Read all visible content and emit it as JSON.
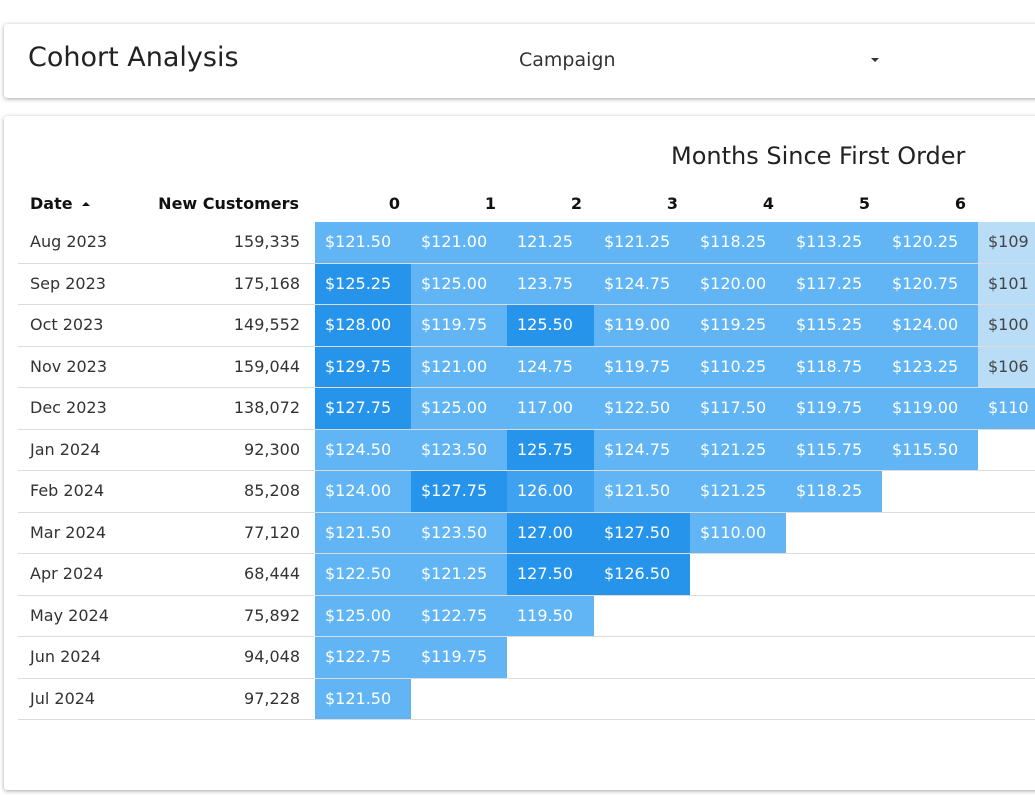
{
  "header": {
    "title": "Cohort Analysis",
    "dropdown_value": "Campaign"
  },
  "table": {
    "group_title": "Months Since First Order",
    "columns": {
      "date": "Date",
      "new_customers": "New Customers",
      "months": [
        "0",
        "1",
        "2",
        "3",
        "4",
        "5",
        "6"
      ]
    },
    "colors": {
      "light": "#62b5f4",
      "medium": "#3ea2f0",
      "dark": "#2794ec",
      "pale": "#b9dcf7"
    },
    "rows": [
      {
        "date": "Aug 2023",
        "new_customers": "159,335",
        "values": [
          "$121.50",
          "$121.00",
          "121.25",
          "$121.25",
          "$118.25",
          "$113.25",
          "$120.25",
          "$109"
        ],
        "shades": [
          "light",
          "light",
          "light",
          "light",
          "light",
          "light",
          "light",
          "pale"
        ]
      },
      {
        "date": "Sep 2023",
        "new_customers": "175,168",
        "values": [
          "$125.25",
          "$125.00",
          "123.75",
          "$124.75",
          "$120.00",
          "$117.25",
          "$120.75",
          "$101"
        ],
        "shades": [
          "dark",
          "light",
          "light",
          "light",
          "light",
          "light",
          "light",
          "pale"
        ]
      },
      {
        "date": "Oct 2023",
        "new_customers": "149,552",
        "values": [
          "$128.00",
          "$119.75",
          "125.50",
          "$119.00",
          "$119.25",
          "$115.25",
          "$124.00",
          "$100"
        ],
        "shades": [
          "dark",
          "light",
          "dark",
          "light",
          "light",
          "light",
          "light",
          "pale"
        ]
      },
      {
        "date": "Nov 2023",
        "new_customers": "159,044",
        "values": [
          "$129.75",
          "$121.00",
          "124.75",
          "$119.75",
          "$110.25",
          "$118.75",
          "$123.25",
          "$106"
        ],
        "shades": [
          "dark",
          "light",
          "light",
          "light",
          "light",
          "light",
          "light",
          "pale"
        ]
      },
      {
        "date": "Dec 2023",
        "new_customers": "138,072",
        "values": [
          "$127.75",
          "$125.00",
          "117.00",
          "$122.50",
          "$117.50",
          "$119.75",
          "$119.00",
          "$110"
        ],
        "shades": [
          "dark",
          "light",
          "light",
          "light",
          "light",
          "light",
          "light",
          "light"
        ]
      },
      {
        "date": "Jan 2024",
        "new_customers": "92,300",
        "values": [
          "$124.50",
          "$123.50",
          "125.75",
          "$124.75",
          "$121.25",
          "$115.75",
          "$115.50"
        ],
        "shades": [
          "light",
          "light",
          "dark",
          "light",
          "light",
          "light",
          "light"
        ]
      },
      {
        "date": "Feb 2024",
        "new_customers": "85,208",
        "values": [
          "$124.00",
          "$127.75",
          "126.00",
          "$121.50",
          "$121.25",
          "$118.25"
        ],
        "shades": [
          "light",
          "dark",
          "medium",
          "light",
          "light",
          "light"
        ]
      },
      {
        "date": "Mar 2024",
        "new_customers": "77,120",
        "values": [
          "$121.50",
          "$123.50",
          "127.00",
          "$127.50",
          "$110.00"
        ],
        "shades": [
          "light",
          "light",
          "dark",
          "dark",
          "light"
        ]
      },
      {
        "date": "Apr 2024",
        "new_customers": "68,444",
        "values": [
          "$122.50",
          "$121.25",
          "127.50",
          "$126.50"
        ],
        "shades": [
          "light",
          "light",
          "dark",
          "dark"
        ]
      },
      {
        "date": "May 2024",
        "new_customers": "75,892",
        "values": [
          "$125.00",
          "$122.75",
          "119.50"
        ],
        "shades": [
          "light",
          "light",
          "light"
        ]
      },
      {
        "date": "Jun 2024",
        "new_customers": "94,048",
        "values": [
          "$122.75",
          "$119.75"
        ],
        "shades": [
          "light",
          "light"
        ]
      },
      {
        "date": "Jul 2024",
        "new_customers": "97,228",
        "values": [
          "$121.50"
        ],
        "shades": [
          "light"
        ]
      }
    ]
  }
}
